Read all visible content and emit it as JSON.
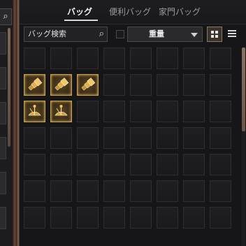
{
  "left": {
    "search_icon": "search-icon"
  },
  "tabs": [
    {
      "label": "バッグ",
      "active": true
    },
    {
      "label": "便利バッグ",
      "active": false
    },
    {
      "label": "家門バッグ",
      "active": false
    }
  ],
  "search": {
    "placeholder": "バッグ検索",
    "icon": "search-icon"
  },
  "filter": {
    "checked": false,
    "selected": "重量"
  },
  "view": {
    "mode": "grid"
  },
  "grid": {
    "columns": 8,
    "rows": 7,
    "items": [
      {
        "slot": 8,
        "icon": "brass-spyglass-icon"
      },
      {
        "slot": 9,
        "icon": "brass-spyglass-icon"
      },
      {
        "slot": 10,
        "icon": "brass-spyglass-icon"
      },
      {
        "slot": 16,
        "icon": "brass-sextant-icon"
      },
      {
        "slot": 17,
        "icon": "brass-sextant-icon"
      }
    ]
  },
  "colors": {
    "accent": "#c9a04a",
    "tab_active": "#f0f0f0",
    "tab_inactive": "#9a9a9a"
  }
}
